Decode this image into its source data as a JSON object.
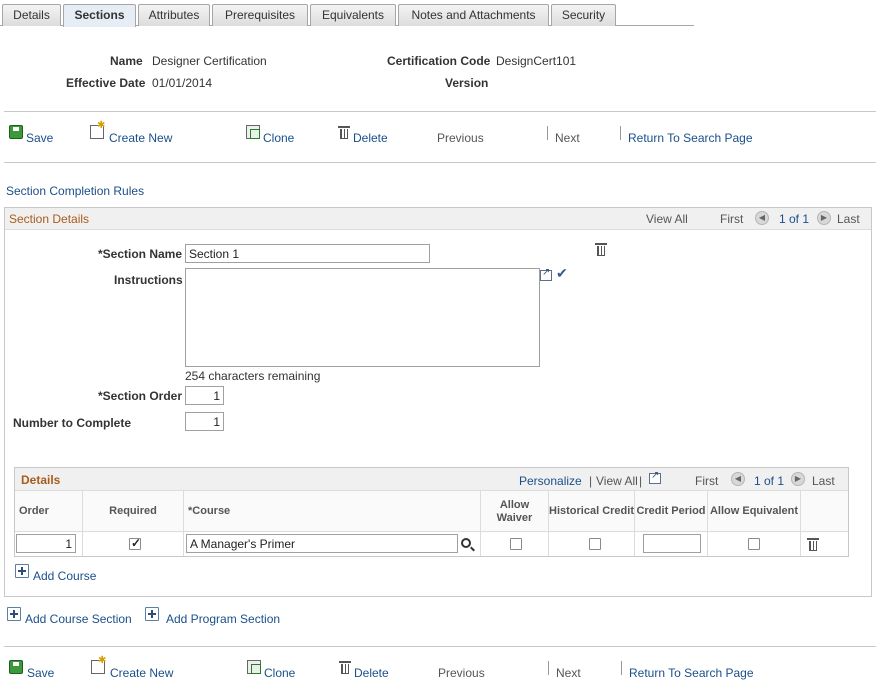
{
  "tabs": [
    {
      "label": "Details",
      "active": false
    },
    {
      "label": "Sections",
      "active": true
    },
    {
      "label": "Attributes",
      "active": false
    },
    {
      "label": "Prerequisites",
      "active": false
    },
    {
      "label": "Equivalents",
      "active": false
    },
    {
      "label": "Notes and Attachments",
      "active": false
    },
    {
      "label": "Security",
      "active": false
    }
  ],
  "header": {
    "name_label": "Name",
    "name_value": "Designer Certification",
    "effective_date_label": "Effective Date",
    "effective_date_value": "01/01/2014",
    "cert_code_label": "Certification Code",
    "cert_code_value": "DesignCert101",
    "version_label": "Version"
  },
  "toolbar": {
    "save": "Save",
    "create_new": "Create New",
    "clone": "Clone",
    "delete": "Delete",
    "previous": "Previous",
    "next": "Next",
    "return": "Return To Search Page"
  },
  "section_completion_rules": "Section Completion Rules",
  "section_details": {
    "title": "Section Details",
    "view_all": "View All",
    "first": "First",
    "range": "1 of 1",
    "last": "Last",
    "section_name_label": "*Section Name",
    "section_name_value": "Section 1",
    "instructions_label": "Instructions",
    "instructions_value": "",
    "chars_remaining": "254 characters remaining",
    "section_order_label": "*Section Order",
    "section_order_value": "1",
    "number_to_complete_label": "Number to Complete",
    "number_to_complete_value": "1"
  },
  "details_grid": {
    "title": "Details",
    "personalize": "Personalize",
    "view_all": "View All",
    "first": "First",
    "range": "1 of 1",
    "last": "Last",
    "columns": {
      "order": "Order",
      "required": "Required",
      "course": "*Course",
      "allow_waiver": "Allow Waiver",
      "historical_credit": "Historical Credit",
      "credit_period": "Credit Period",
      "allow_equivalent": "Allow Equivalent"
    },
    "rows": [
      {
        "order": "1",
        "required": true,
        "course": "A Manager's Primer",
        "allow_waiver": false,
        "historical_credit": false,
        "credit_period": "",
        "allow_equivalent": false
      }
    ],
    "add_course": "Add Course"
  },
  "add_course_section": "Add Course Section",
  "add_program_section": "Add Program Section"
}
